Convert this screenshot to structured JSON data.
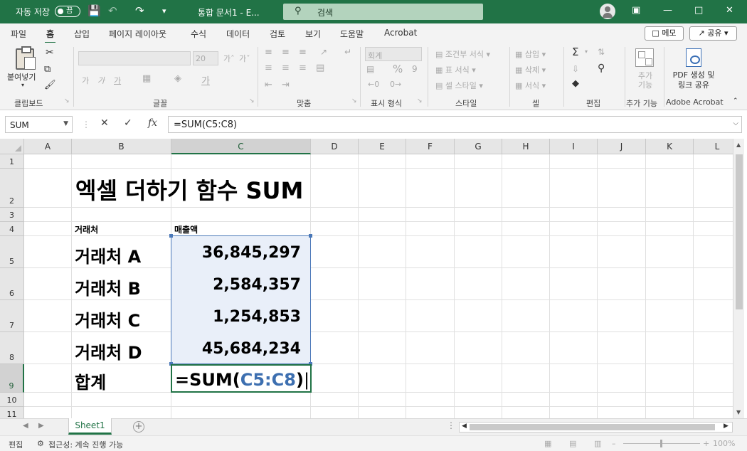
{
  "titlebar": {
    "autosave_label": "자동 저장",
    "autosave_state": "끔",
    "doc_title": "통합 문서1 - E...",
    "search_placeholder": "검색",
    "accent_color": "#217346"
  },
  "tabs": [
    "파일",
    "홈",
    "삽입",
    "페이지 레이아웃",
    "수식",
    "데이터",
    "검토",
    "보기",
    "도움말",
    "Acrobat"
  ],
  "tab_buttons": {
    "memo": "메모",
    "share": "공유"
  },
  "ribbon": {
    "clipboard": {
      "paste": "붙여넣기",
      "label": "클립보드"
    },
    "font": {
      "size": "20",
      "label": "글꼴"
    },
    "alignment": {
      "label": "맞춤"
    },
    "number": {
      "format": "회계",
      "label": "표시 형식"
    },
    "styles": {
      "items": [
        "조건부 서식",
        "표 서식",
        "셀 스타일"
      ],
      "label": "스타일"
    },
    "cells": {
      "items": [
        "삽입",
        "삭제",
        "서식"
      ],
      "label": "셀"
    },
    "editing": {
      "label": "편집"
    },
    "addins": {
      "button": "추가 기능",
      "label": "추가 기능"
    },
    "acrobat": {
      "button": "PDF 생성 및 링크 공유",
      "label": "Adobe Acrobat"
    }
  },
  "formula_bar": {
    "name_box": "SUM",
    "formula": "=SUM(C5:C8)"
  },
  "columns": [
    "A",
    "B",
    "C",
    "D",
    "E",
    "F",
    "G",
    "H",
    "I",
    "J",
    "K",
    "L"
  ],
  "rows": [
    "1",
    "2",
    "3",
    "4",
    "5",
    "6",
    "7",
    "8",
    "9",
    "10",
    "11"
  ],
  "sheet": {
    "title": "엑셀 더하기 함수 SUM",
    "header_vendor": "거래처",
    "header_sales": "매출액",
    "vendors": [
      "거래처 A",
      "거래처 B",
      "거래처 C",
      "거래처 D"
    ],
    "sales": [
      "36,845,297",
      "2,584,357",
      "1,254,853",
      "45,684,234"
    ],
    "total_label": "합계",
    "formula_prefix": "=SUM(",
    "formula_ref": "C5:C8",
    "formula_suffix": ")",
    "ref_color": "#3d6fb0"
  },
  "sheet_tabs": [
    "Sheet1"
  ],
  "status": {
    "mode": "편집",
    "accessibility": "접근성: 계속 진행 가능",
    "zoom": "100%"
  }
}
